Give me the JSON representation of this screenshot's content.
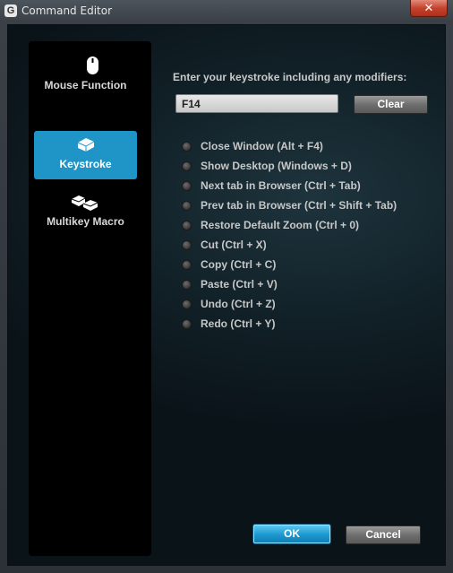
{
  "window": {
    "title": "Command Editor",
    "app_icon_glyph": "G",
    "close_glyph": "✕"
  },
  "sidebar": {
    "items": [
      {
        "label": "Mouse Function",
        "icon": "mouse-icon",
        "active": false
      },
      {
        "label": "Keystroke",
        "icon": "keyboard-key-icon",
        "active": true
      },
      {
        "label": "Multikey Macro",
        "icon": "multikey-icon",
        "active": false
      }
    ]
  },
  "main": {
    "prompt": "Enter your keystroke including any modifiers:",
    "keystroke_value": "F14",
    "clear_label": "Clear",
    "options": [
      "Close Window (Alt + F4)",
      "Show Desktop (Windows + D)",
      "Next tab in Browser (Ctrl + Tab)",
      "Prev tab in Browser (Ctrl + Shift + Tab)",
      "Restore Default Zoom (Ctrl + 0)",
      "Cut (Ctrl + X)",
      "Copy (Ctrl + C)",
      "Paste (Ctrl + V)",
      "Undo (Ctrl + Z)",
      "Redo (Ctrl + Y)"
    ]
  },
  "footer": {
    "ok_label": "OK",
    "cancel_label": "Cancel"
  },
  "colors": {
    "accent": "#1f95c7",
    "close_red": "#c4432e"
  }
}
